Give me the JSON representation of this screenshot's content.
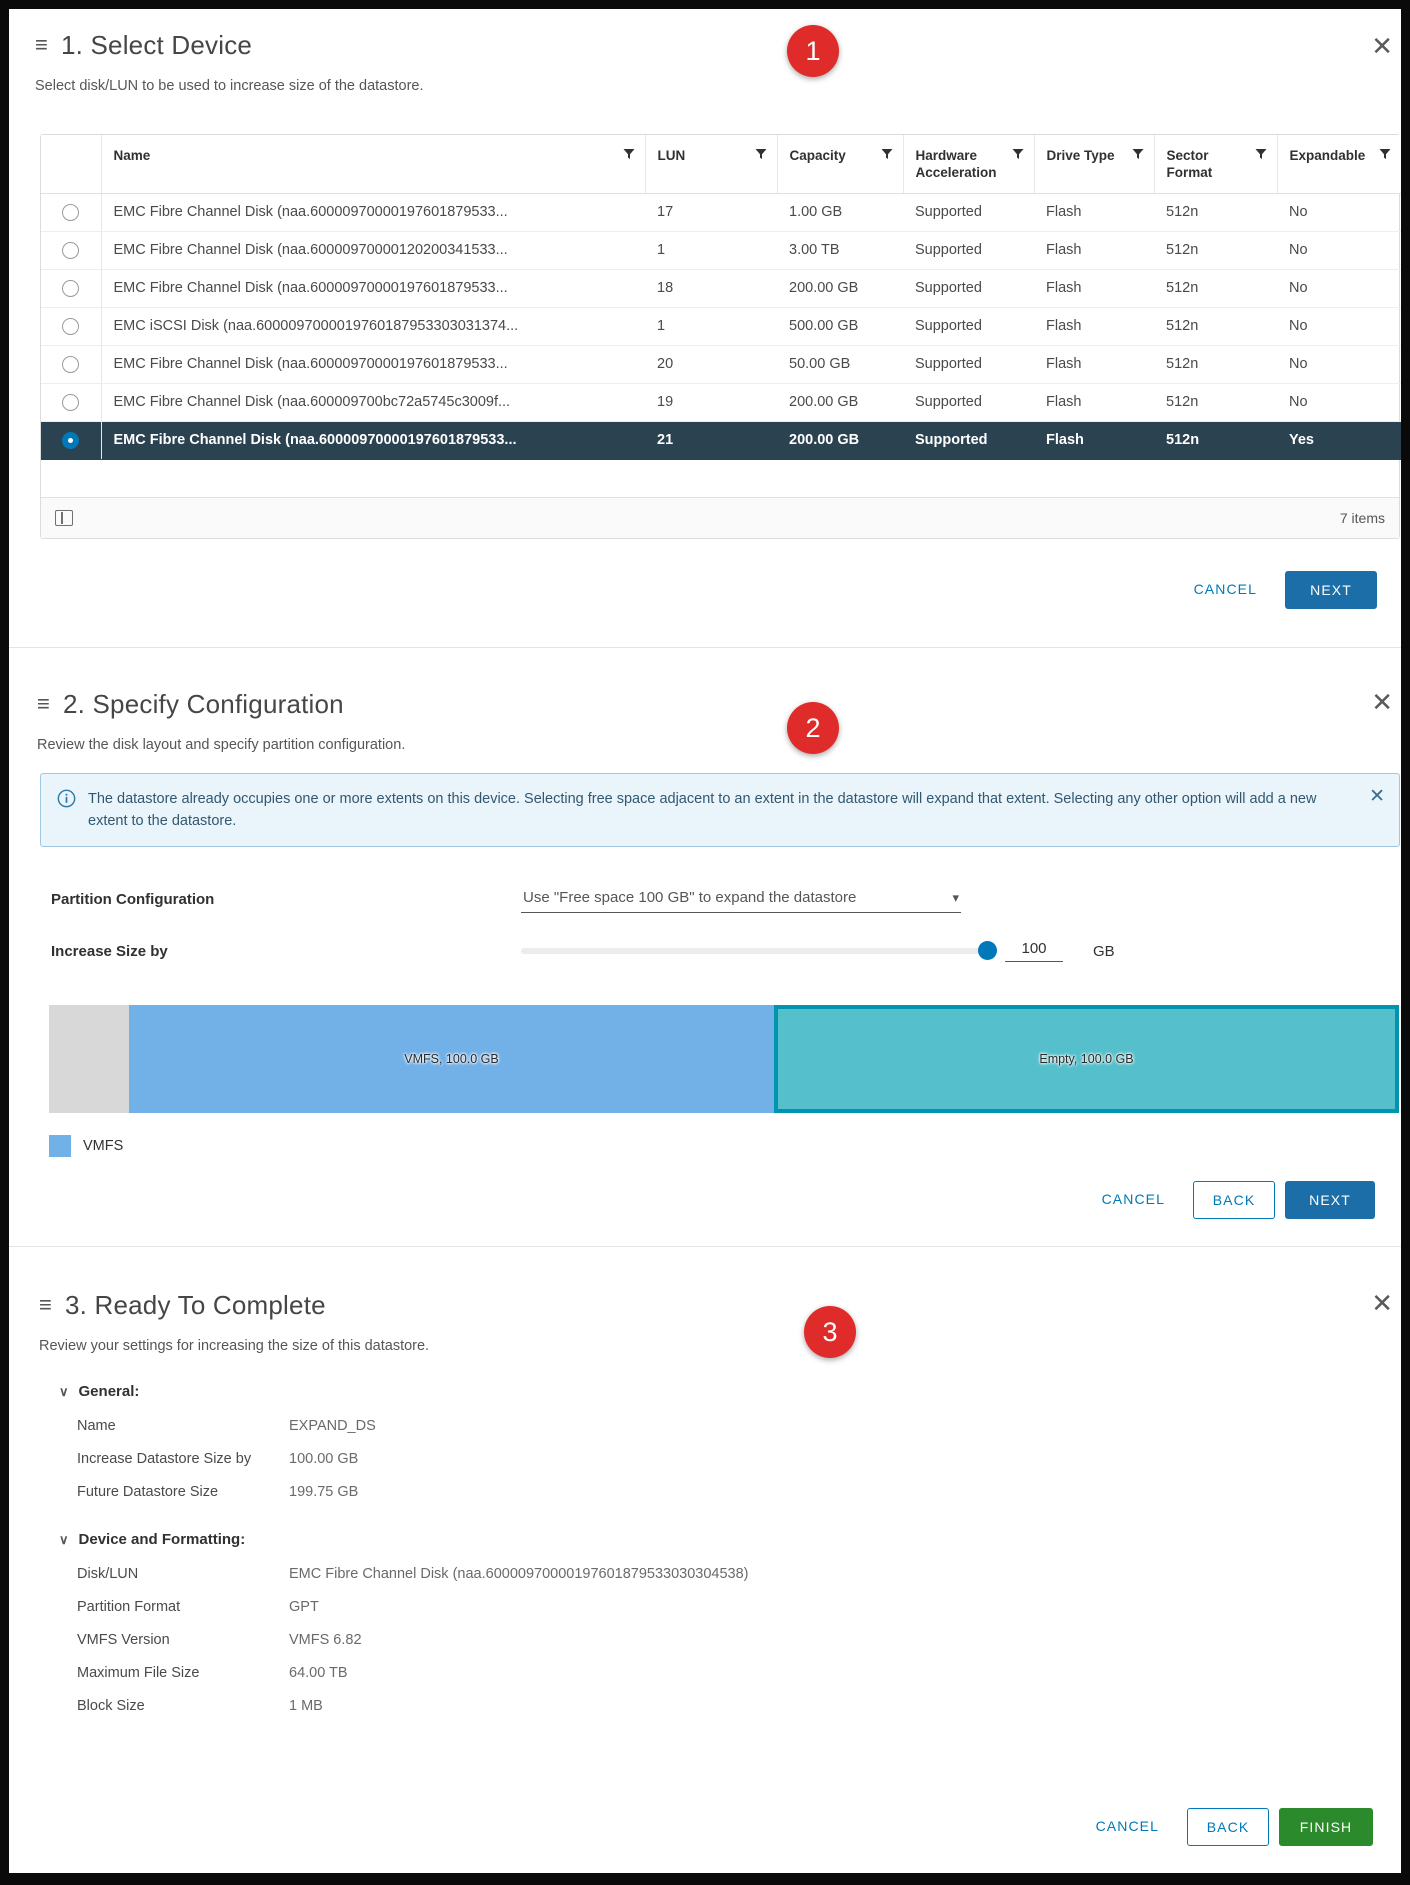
{
  "step1": {
    "hamburger": "hamburger-icon",
    "badge": "1",
    "title": "1. Select Device",
    "subtitle": "Select disk/LUN to be used to increase size of the datastore.",
    "close": "✕",
    "columns": [
      "Name",
      "LUN",
      "Capacity",
      "Hardware Acceleration",
      "Drive Type",
      "Sector Format",
      "Expandable"
    ],
    "rows": [
      {
        "selected": false,
        "name": "EMC Fibre Channel Disk (naa.60000970000197601879533...",
        "lun": "17",
        "capacity": "1.00 GB",
        "hardware_acceleration": "Supported",
        "drive_type": "Flash",
        "sector_format": "512n",
        "expandable": "No"
      },
      {
        "selected": false,
        "name": "EMC Fibre Channel Disk (naa.60000970000120200341533...",
        "lun": "1",
        "capacity": "3.00 TB",
        "hardware_acceleration": "Supported",
        "drive_type": "Flash",
        "sector_format": "512n",
        "expandable": "No"
      },
      {
        "selected": false,
        "name": "EMC Fibre Channel Disk (naa.60000970000197601879533...",
        "lun": "18",
        "capacity": "200.00 GB",
        "hardware_acceleration": "Supported",
        "drive_type": "Flash",
        "sector_format": "512n",
        "expandable": "No"
      },
      {
        "selected": false,
        "name": "EMC iSCSI Disk (naa.6000097000019760187953303031374...",
        "lun": "1",
        "capacity": "500.00 GB",
        "hardware_acceleration": "Supported",
        "drive_type": "Flash",
        "sector_format": "512n",
        "expandable": "No"
      },
      {
        "selected": false,
        "name": "EMC Fibre Channel Disk (naa.60000970000197601879533...",
        "lun": "20",
        "capacity": "50.00 GB",
        "hardware_acceleration": "Supported",
        "drive_type": "Flash",
        "sector_format": "512n",
        "expandable": "No"
      },
      {
        "selected": false,
        "name": "EMC Fibre Channel Disk (naa.600009700bc72a5745c3009f...",
        "lun": "19",
        "capacity": "200.00 GB",
        "hardware_acceleration": "Supported",
        "drive_type": "Flash",
        "sector_format": "512n",
        "expandable": "No"
      },
      {
        "selected": true,
        "name": "EMC Fibre Channel Disk (naa.60000970000197601879533...",
        "lun": "21",
        "capacity": "200.00 GB",
        "hardware_acceleration": "Supported",
        "drive_type": "Flash",
        "sector_format": "512n",
        "expandable": "Yes"
      }
    ],
    "item_count": "7 items",
    "cancel_label": "CANCEL",
    "next_label": "NEXT"
  },
  "step2": {
    "badge": "2",
    "title": "2. Specify Configuration",
    "subtitle": "Review the disk layout and specify partition configuration.",
    "close": "✕",
    "alert": {
      "icon": "info-circle-icon",
      "text": "The datastore already occupies one or more extents on this device. Selecting free space adjacent to an extent in the datastore will expand that extent. Selecting any other option will add a new extent to the datastore.",
      "close": "✕"
    },
    "partition_label": "Partition Configuration",
    "partition_value": "Use \"Free space 100 GB\" to expand the datastore",
    "increase_label": "Increase Size by",
    "increase_value": "100",
    "increase_unit": "GB",
    "disk": {
      "system_label": "",
      "vmfs_label": "VMFS, 100.0 GB",
      "empty_label": "Empty, 100.0 GB"
    },
    "legend_label": "VMFS",
    "cancel_label": "CANCEL",
    "back_label": "BACK",
    "next_label": "NEXT"
  },
  "step3": {
    "badge": "3",
    "title": "3. Ready To Complete",
    "subtitle": "Review your settings for increasing the size of this datastore.",
    "close": "✕",
    "groups": [
      {
        "title": "General:",
        "rows": [
          {
            "key": "Name",
            "value": "EXPAND_DS"
          },
          {
            "key": "Increase Datastore Size by",
            "value": "100.00 GB"
          },
          {
            "key": "Future Datastore Size",
            "value": "199.75 GB"
          }
        ]
      },
      {
        "title": "Device and Formatting:",
        "rows": [
          {
            "key": "Disk/LUN",
            "value": "EMC Fibre Channel Disk (naa.60000970000197601879533030304538)"
          },
          {
            "key": "Partition Format",
            "value": "GPT"
          },
          {
            "key": "VMFS Version",
            "value": "VMFS 6.82"
          },
          {
            "key": "Maximum File Size",
            "value": "64.00 TB"
          },
          {
            "key": "Block Size",
            "value": "1 MB"
          }
        ]
      }
    ],
    "cancel_label": "CANCEL",
    "back_label": "BACK",
    "finish_label": "FINISH"
  },
  "colors": {
    "accent": "#0079b8",
    "primary_button": "#1b6ea8",
    "finish_button": "#2b8a2b",
    "badge_red": "#e02b2b",
    "selected_row": "#2b4250",
    "vmfs": "#72b0e8",
    "empty": "#55c0cc",
    "empty_border": "#0094ae",
    "system": "#d8d8d8",
    "alert_bg": "#eaf4fb",
    "alert_border": "#9fc8e0"
  }
}
